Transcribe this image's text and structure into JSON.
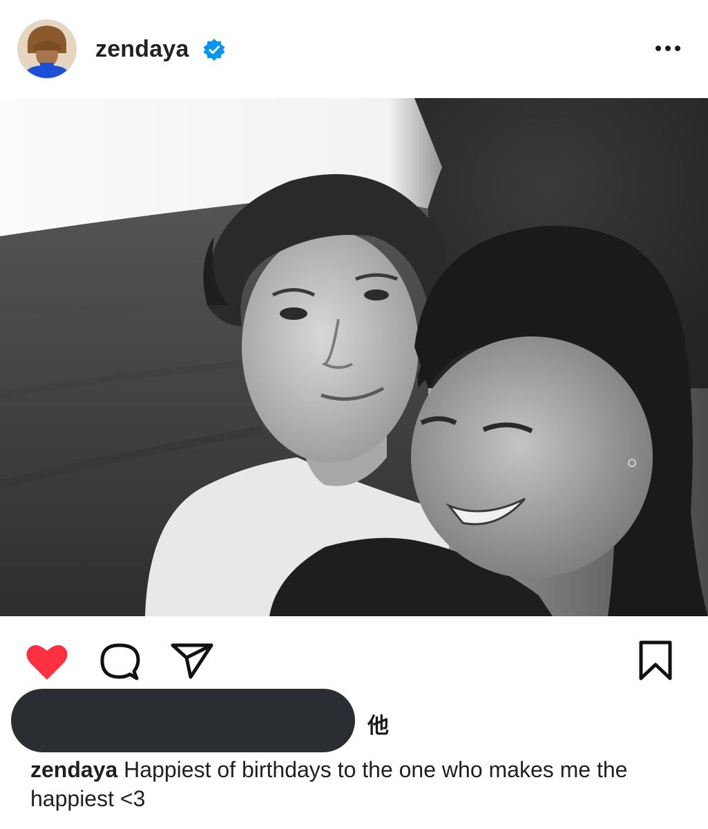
{
  "header": {
    "username": "zendaya",
    "verified_icon": "verified-badge-icon",
    "more_icon": "more-options-icon"
  },
  "post": {
    "image_description_icon": "photo",
    "tag_icon": "user-tag-icon"
  },
  "actions": {
    "like_icon": "heart-filled-icon",
    "comment_icon": "comment-icon",
    "share_icon": "send-icon",
    "save_icon": "bookmark-icon",
    "liked": true
  },
  "likes": {
    "suffix": "他"
  },
  "caption": {
    "username": "zendaya",
    "text": "Happiest of birthdays to the one who makes me the happiest <3"
  },
  "colors": {
    "like": "#ff3040",
    "verified": "#0095f6",
    "text": "#1f1f1f",
    "redaction": "#2a2e33"
  }
}
